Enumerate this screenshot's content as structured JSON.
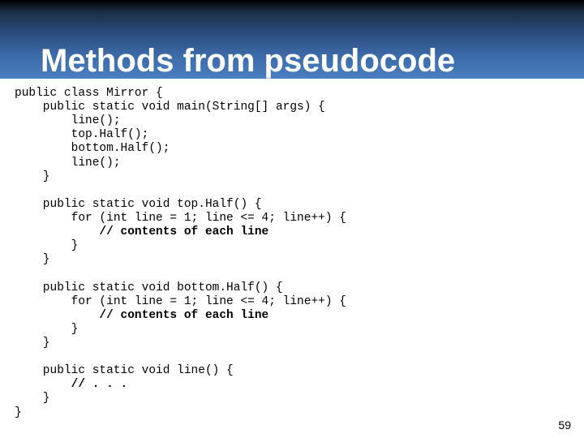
{
  "title": "Methods from pseudocode",
  "code_lines": [
    "public class Mirror {",
    "    public static void main(String[] args) {",
    "        line();",
    "        top.Half();",
    "        bottom.Half();",
    "        line();",
    "    }",
    "",
    "    public static void top.Half() {",
    "        for (int line = 1; line <= 4; line++) {",
    "            <b>// contents of each line</b>",
    "        }",
    "    }",
    "",
    "    public static void bottom.Half() {",
    "        for (int line = 1; line <= 4; line++) {",
    "            <b>// contents of each line</b>",
    "        }",
    "    }",
    "",
    "    public static void line() {",
    "        <b>// . . .</b>",
    "    }",
    "}"
  ],
  "page_number": "59"
}
